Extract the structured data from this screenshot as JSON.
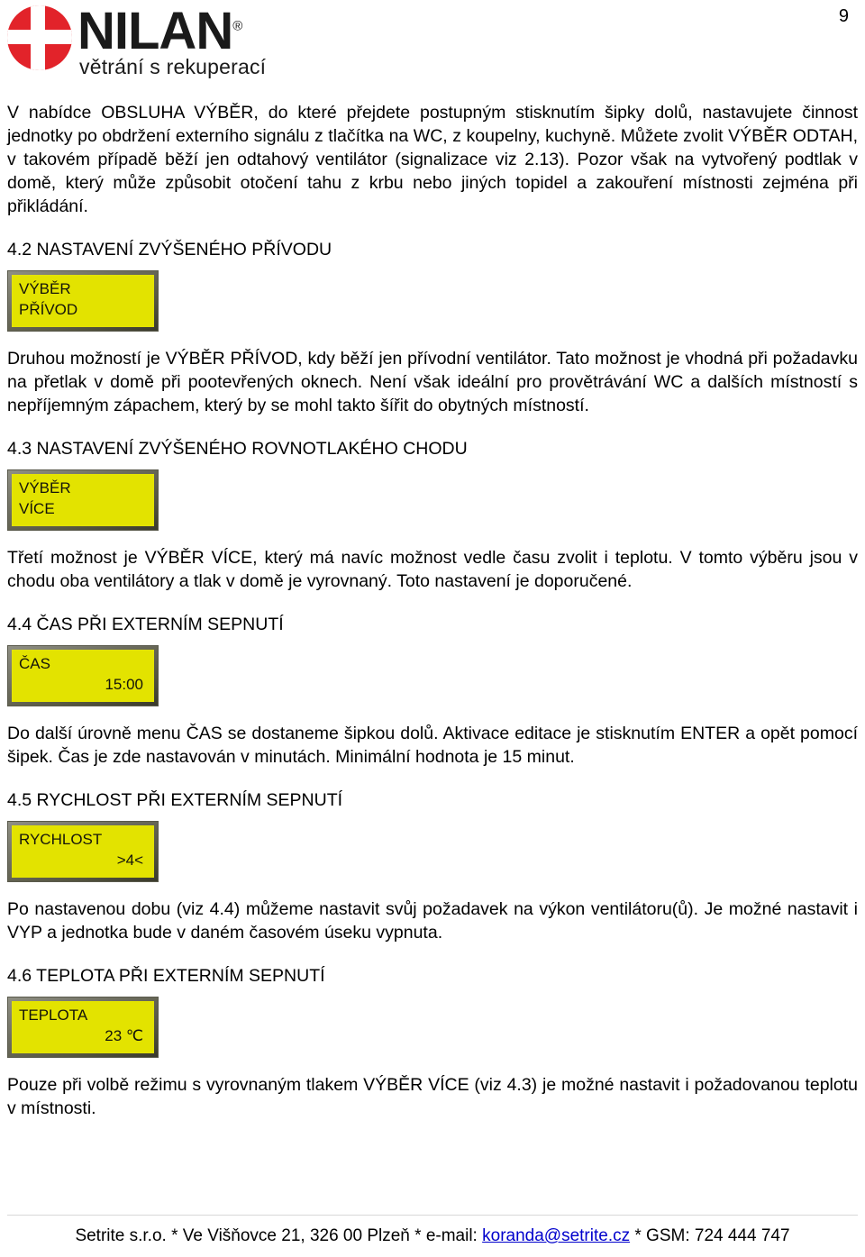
{
  "page": {
    "number": "9"
  },
  "header": {
    "logo_name": "NILAN",
    "logo_registered": "®",
    "logo_tagline": "větrání s rekuperací"
  },
  "content": {
    "intro_paragraph": "V nabídce OBSLUHA VÝBĚR, do které přejdete postupným stisknutím šipky dolů, nastavujete činnost jednotky po obdržení externího signálu z tlačítka na WC, z koupelny, kuchyně. Můžete zvolit VÝBĚR ODTAH, v takovém případě běží jen odtahový ventilátor (signalizace viz 2.13). Pozor však na vytvořený podtlak v domě, který může způsobit otočení tahu z krbu nebo jiných topidel a zakouření místnosti zejména při přikládání.",
    "sections": [
      {
        "heading": "4.2 NASTAVENÍ ZVÝŠENÉHO PŘÍVODU",
        "lcd": {
          "line1": "VÝBĚR",
          "line2": "PŘÍVOD",
          "line2_align": "left"
        },
        "paragraph": "Druhou možností je VÝBĚR PŘÍVOD, kdy běží jen přívodní ventilátor. Tato možnost je vhodná při požadavku na přetlak v domě při pootevřených oknech. Není však ideální pro provětrávání WC a dalších místností s nepříjemným zápachem, který by se mohl takto šířit do obytných místností."
      },
      {
        "heading": "4.3 NASTAVENÍ ZVÝŠENÉHO ROVNOTLAKÉHO CHODU",
        "lcd": {
          "line1": "VÝBĚR",
          "line2": "VÍCE",
          "line2_align": "left"
        },
        "paragraph": "Třetí možnost je VÝBĚR VÍCE, který má navíc možnost vedle času zvolit i teplotu. V tomto výběru jsou v chodu oba ventilátory a tlak v domě je vyrovnaný. Toto nastavení je doporučené."
      },
      {
        "heading": "4.4 ČAS PŘI EXTERNÍM SEPNUTÍ",
        "lcd": {
          "line1": "ČAS",
          "line2": "15:00",
          "line2_align": "right"
        },
        "paragraph": "Do další úrovně menu ČAS se dostaneme šipkou dolů. Aktivace editace je stisknutím ENTER a opět pomocí šipek. Čas je zde nastavován v minutách. Minimální hodnota je 15 minut."
      },
      {
        "heading": "4.5 RYCHLOST PŘI EXTERNÍM SEPNUTÍ",
        "lcd": {
          "line1": "RYCHLOST",
          "line2": ">4<",
          "line2_align": "right"
        },
        "paragraph": "Po nastavenou dobu (viz 4.4) můžeme nastavit svůj požadavek na výkon ventilátoru(ů). Je možné nastavit i VYP a jednotka bude v daném časovém úseku vypnuta."
      },
      {
        "heading": "4.6 TEPLOTA PŘI EXTERNÍM SEPNUTÍ",
        "lcd": {
          "line1": "TEPLOTA",
          "line2": "23 ℃",
          "line2_align": "right"
        },
        "paragraph": "Pouze při volbě režimu s vyrovnaným tlakem VÝBĚR VÍCE (viz 4.3) je možné nastavit i požadovanou teplotu v místnosti."
      }
    ]
  },
  "footer": {
    "before_email": "Setrite s.r.o. * Ve Višňovce 21, 326 00 Plzeň * e-mail: ",
    "email": "koranda@setrite.cz",
    "after_email": " * GSM: 724 444 747"
  },
  "colors": {
    "logo_red": "#e2232a",
    "lcd_screen": "#e3e300",
    "lcd_bezel": "#55553f",
    "link": "#0000cc"
  }
}
